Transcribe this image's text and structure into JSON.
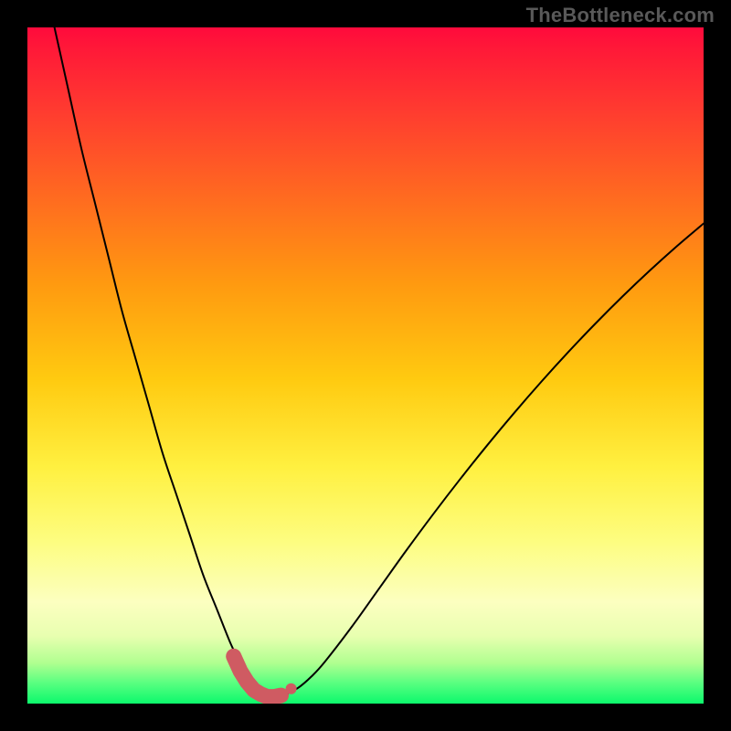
{
  "watermark": {
    "text": "TheBottleneck.com"
  },
  "colors": {
    "curve": "#000000",
    "marker_fill": "#cf5b62",
    "marker_stroke": "#cf5b62"
  },
  "chart_data": {
    "type": "line",
    "title": "",
    "xlabel": "",
    "ylabel": "",
    "xlim": [
      0,
      100
    ],
    "ylim": [
      0,
      100
    ],
    "grid": false,
    "series": [
      {
        "name": "bottleneck-curve",
        "x": [
          4,
          6,
          8,
          10,
          12,
          14,
          16,
          18,
          20,
          22,
          24,
          26,
          28,
          30,
          31,
          32,
          33,
          34,
          35,
          36,
          37,
          38,
          40,
          42,
          44,
          48,
          52,
          56,
          60,
          64,
          68,
          72,
          76,
          80,
          84,
          88,
          92,
          96,
          100
        ],
        "y": [
          100,
          91,
          82,
          74,
          66,
          58,
          51,
          44,
          37,
          31,
          25,
          19,
          14,
          9,
          7,
          5.2,
          3.6,
          2.4,
          1.5,
          1.0,
          1.0,
          1.3,
          2.3,
          4.0,
          6.2,
          11.4,
          17.0,
          22.6,
          28.0,
          33.2,
          38.2,
          43.0,
          47.6,
          52.0,
          56.2,
          60.2,
          64.0,
          67.6,
          71.0
        ]
      }
    ],
    "markers": {
      "name": "highlight-points",
      "x": [
        30.5,
        31.5,
        32.5,
        33.5,
        34.5,
        35.5,
        36.5,
        37.5,
        39.0
      ],
      "y": [
        7.0,
        4.8,
        3.2,
        2.0,
        1.4,
        1.0,
        1.0,
        1.2,
        2.2
      ]
    }
  }
}
